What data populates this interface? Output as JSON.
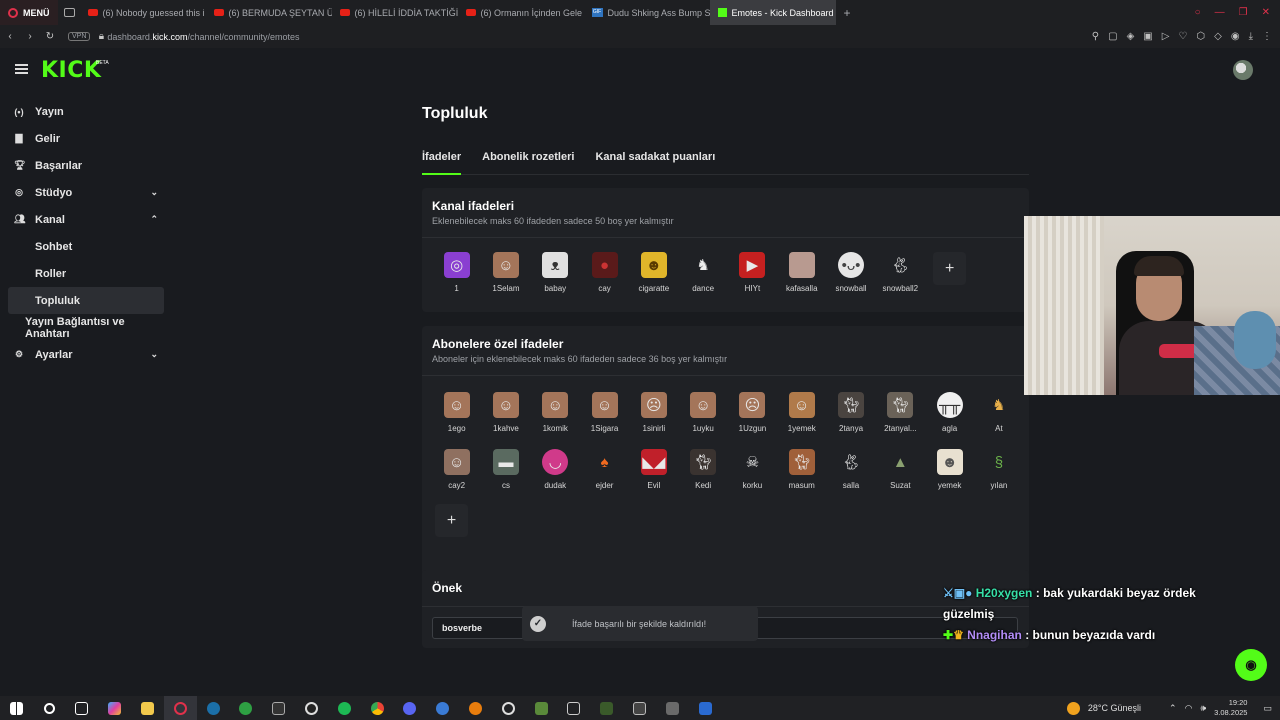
{
  "browser": {
    "menu_label": "MENÜ",
    "tabs": [
      {
        "title": "(6) Nobody guessed this i"
      },
      {
        "title": "(6) BERMUDA ŞEYTAN Ü"
      },
      {
        "title": "(6) HİLELİ İDDİA TAKTİĞİ"
      },
      {
        "title": "(6) Ormanın İçinden Gele"
      },
      {
        "title": "Dudu Shking Ass Bump S"
      },
      {
        "title": "Emotes - Kick Dashboard"
      }
    ],
    "vpn": "VPN",
    "url_prefix": "dashboard.",
    "url_domain": "kick.com",
    "url_path": "/channel/community/emotes"
  },
  "header": {
    "logo": "KICK",
    "logo_badge": "BETA"
  },
  "sidebar": {
    "items": [
      {
        "label": "Yayın"
      },
      {
        "label": "Gelir"
      },
      {
        "label": "Başarılar"
      },
      {
        "label": "Stüdyo"
      },
      {
        "label": "Kanal"
      },
      {
        "label": "Sohbet"
      },
      {
        "label": "Roller"
      },
      {
        "label": "Topluluk"
      },
      {
        "label": "Yayın Bağlantısı ve Anahtarı"
      },
      {
        "label": "Ayarlar"
      }
    ]
  },
  "page": {
    "title": "Topluluk",
    "tabs": [
      {
        "label": "İfadeler"
      },
      {
        "label": "Abonelik rozetleri"
      },
      {
        "label": "Kanal sadakat puanları"
      }
    ]
  },
  "channel_emotes": {
    "title": "Kanal ifadeleri",
    "subtitle": "Eklenebilecek maks 60 ifadeden sadece 50 boş yer kalmıştır",
    "emotes": [
      "1",
      "1Selam",
      "babay",
      "cay",
      "cigaratte",
      "dance",
      "HIYt",
      "kafasalla",
      "snowball",
      "snowball2"
    ],
    "add_icon": "+"
  },
  "sub_emotes": {
    "title": "Abonelere özel ifadeler",
    "subtitle": "Aboneler için eklenebilecek maks 60 ifadeden sadece 36 boş yer kalmıştır",
    "row1": [
      "1ego",
      "1kahve",
      "1komik",
      "1Sigara",
      "1sinirli",
      "1uyku",
      "1Uzgun",
      "1yemek",
      "2tanya",
      "2tanyal...",
      "agla",
      "At"
    ],
    "row2": [
      "cay2",
      "cs",
      "dudak",
      "ejder",
      "Evil",
      "Kedi",
      "korku",
      "masum",
      "salla",
      "Suzat",
      "yemek",
      "yılan"
    ],
    "add_icon": "+"
  },
  "prefix": {
    "title": "Önek",
    "value": "bosverbe"
  },
  "toast": {
    "message": "İfade başarılı bir şekilde kaldırıldı!",
    "icon": "✓"
  },
  "chat": {
    "line1_user": "H20xygen",
    "line1_text": ": bak yukardaki beyaz ördek",
    "line1_cont": "güzelmiş",
    "line2_user": "Nnagihan",
    "line2_text": ": bunun beyazıda vardı"
  },
  "taskbar": {
    "weather": "28°C  Güneşli",
    "time": "19:20",
    "date": "3.08.2025"
  }
}
